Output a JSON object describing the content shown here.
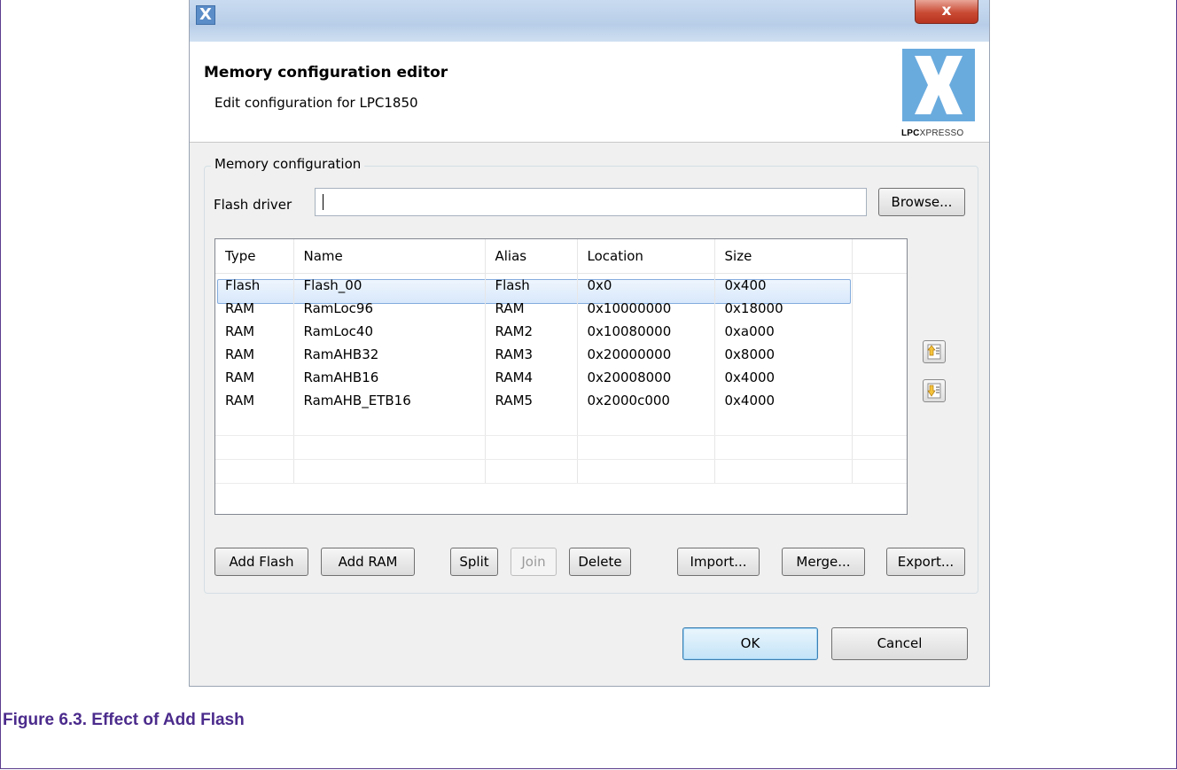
{
  "window": {
    "close_label": "x",
    "app_icon_glyph": "X"
  },
  "header": {
    "title": "Memory configuration editor",
    "subtitle": "Edit configuration for LPC1850",
    "logo_text_bold": "LPC",
    "logo_text": "XPRESSO"
  },
  "group": {
    "label": "Memory configuration",
    "flash_driver_label": "Flash driver",
    "flash_driver_value": "",
    "browse_label": "Browse..."
  },
  "table": {
    "columns": [
      "Type",
      "Name",
      "Alias",
      "Location",
      "Size"
    ],
    "rows": [
      [
        "Flash",
        "Flash_00",
        "Flash",
        "0x0",
        "0x400"
      ],
      [
        "RAM",
        "RamLoc96",
        "RAM",
        "0x10000000",
        "0x18000"
      ],
      [
        "RAM",
        "RamLoc40",
        "RAM2",
        "0x10080000",
        "0xa000"
      ],
      [
        "RAM",
        "RamAHB32",
        "RAM3",
        "0x20000000",
        "0x8000"
      ],
      [
        "RAM",
        "RamAHB16",
        "RAM4",
        "0x20008000",
        "0x4000"
      ],
      [
        "RAM",
        "RamAHB_ETB16",
        "RAM5",
        "0x2000c000",
        "0x4000"
      ]
    ]
  },
  "buttons": {
    "add_flash": "Add Flash",
    "add_ram": "Add RAM",
    "split": "Split",
    "join": "Join",
    "delete": "Delete",
    "import": "Import...",
    "merge": "Merge...",
    "export": "Export...",
    "ok": "OK",
    "cancel": "Cancel"
  },
  "caption": "Figure 6.3. Effect of Add Flash",
  "colors": {
    "caption": "#4b2b8c",
    "selection": "#dcebfc",
    "logo": "#6aabde"
  }
}
